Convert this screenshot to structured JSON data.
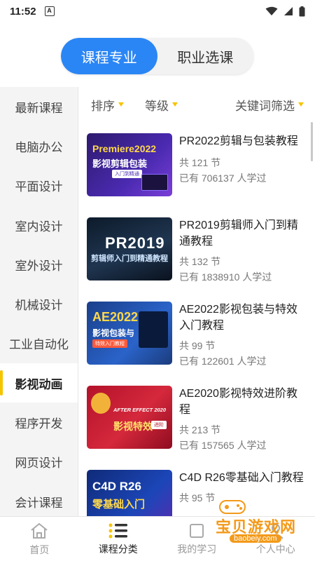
{
  "status_bar": {
    "time": "11:52",
    "notification_icon": "A"
  },
  "tabs": [
    {
      "label": "课程专业",
      "active": true
    },
    {
      "label": "职业选课",
      "active": false
    }
  ],
  "sidebar": {
    "items": [
      {
        "label": "最新课程"
      },
      {
        "label": "电脑办公"
      },
      {
        "label": "平面设计"
      },
      {
        "label": "室内设计"
      },
      {
        "label": "室外设计"
      },
      {
        "label": "机械设计"
      },
      {
        "label": "工业自动化"
      },
      {
        "label": "影视动画",
        "active": true
      },
      {
        "label": "程序开发"
      },
      {
        "label": "网页设计"
      },
      {
        "label": "会计课程"
      }
    ]
  },
  "filters": {
    "sort": "排序",
    "level": "等级",
    "keyword": "关键词筛选"
  },
  "courses": [
    {
      "title": "PR2022剪辑与包装教程",
      "lessons": "共 121 节",
      "learners": "已有 706137 人学过",
      "thumb": {
        "line1": "Premiere2022",
        "line2": "影视剪辑包装",
        "tag": "入门到精通"
      }
    },
    {
      "title": "PR2019剪辑师入门到精通教程",
      "lessons": "共 132 节",
      "learners": "已有 1838910 人学过",
      "thumb": {
        "line1": "PR2019",
        "line2": "剪辑师入门到精通教程"
      }
    },
    {
      "title": "AE2022影视包装与特效入门教程",
      "lessons": "共 99 节",
      "learners": "已有 122601 人学过",
      "thumb": {
        "line1": "AE2022",
        "line2": "影视包装与",
        "tag": "特效入门教程"
      }
    },
    {
      "title": "AE2020影视特效进阶教程",
      "lessons": "共 213 节",
      "learners": "已有 157565 人学过",
      "thumb": {
        "line1": "AFTER EFFECT 2020",
        "line2": "影视特效",
        "tag": "进阶"
      }
    },
    {
      "title": "C4D R26零基础入门教程",
      "lessons": "共 95 节",
      "learners": "",
      "thumb": {
        "line1": "C4D R26",
        "line2": "零基础入门"
      }
    }
  ],
  "bottom_nav": [
    {
      "label": "首页",
      "icon": "home-icon"
    },
    {
      "label": "课程分类",
      "icon": "category-list-icon",
      "active": true
    },
    {
      "label": "我的学习",
      "icon": "book-icon"
    },
    {
      "label": "个人中心",
      "icon": "person-icon"
    }
  ],
  "watermark": {
    "text": "宝贝游戏网",
    "url": "baobeiy.com"
  },
  "colors": {
    "accent_blue": "#2b86f5",
    "accent_yellow": "#f5c400",
    "watermark_orange": "#f39a1a"
  }
}
